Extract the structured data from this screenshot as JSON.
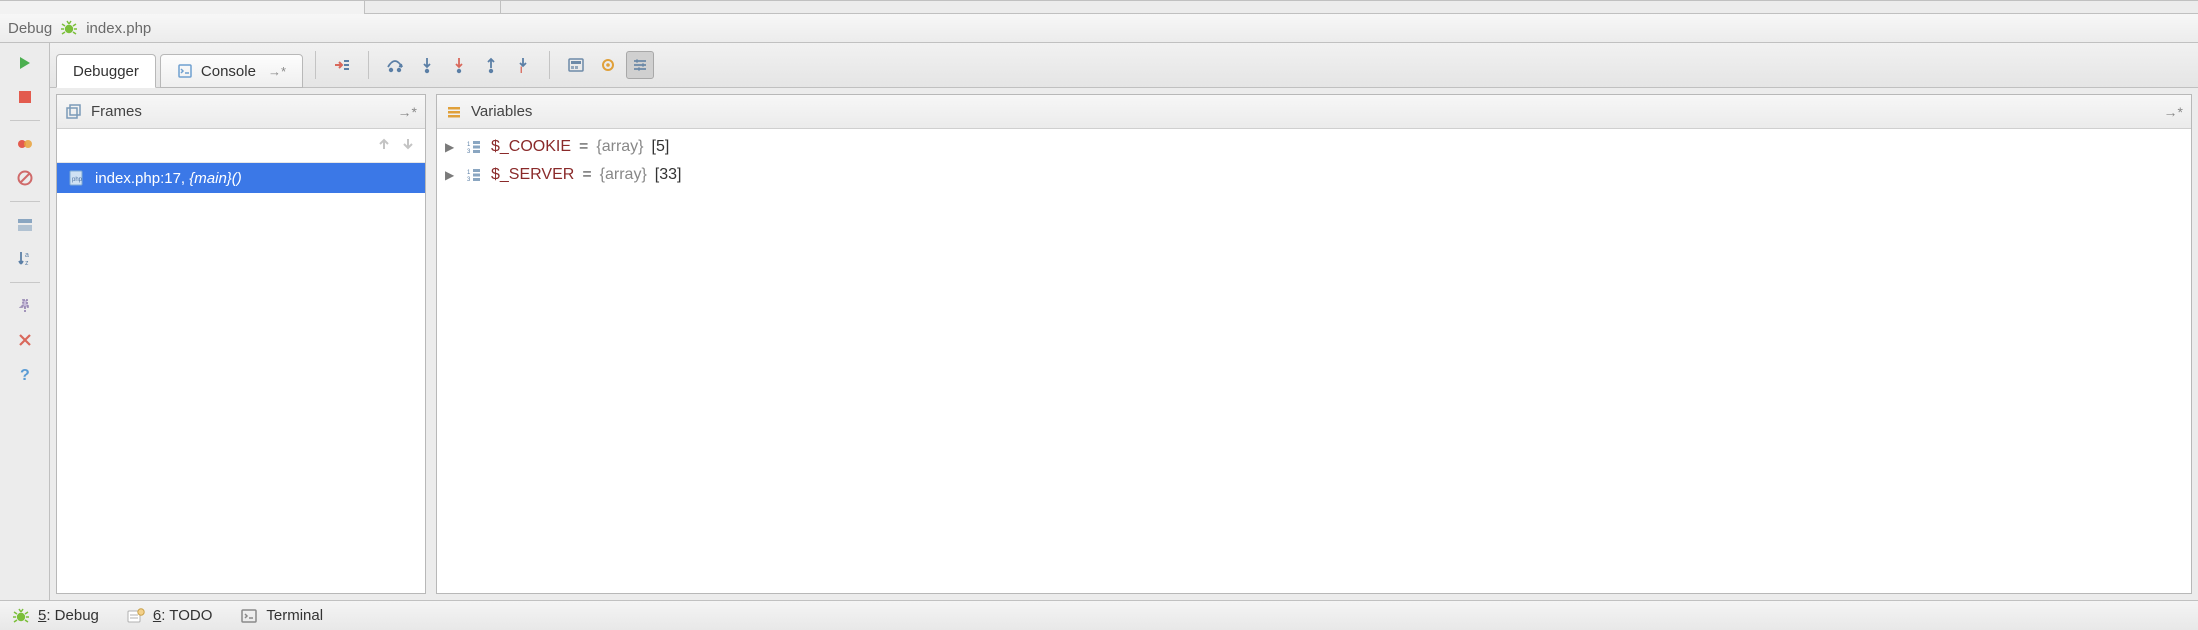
{
  "toolwindow": {
    "name": "Debug",
    "file": "index.php"
  },
  "tabs": {
    "debugger": "Debugger",
    "console": "Console"
  },
  "panels": {
    "frames_title": "Frames",
    "variables_title": "Variables"
  },
  "frames": [
    {
      "file": "index.php",
      "line": "17",
      "suffix": ", ",
      "ctx": "{main}()"
    }
  ],
  "variables": [
    {
      "name": "$_COOKIE",
      "type": "{array}",
      "count": "[5]"
    },
    {
      "name": "$_SERVER",
      "type": "{array}",
      "count": "[33]"
    }
  ],
  "bottom": {
    "debug_num": "5",
    "debug_label": ": Debug",
    "todo_num": "6",
    "todo_label": ": TODO",
    "terminal_label": "Terminal"
  }
}
